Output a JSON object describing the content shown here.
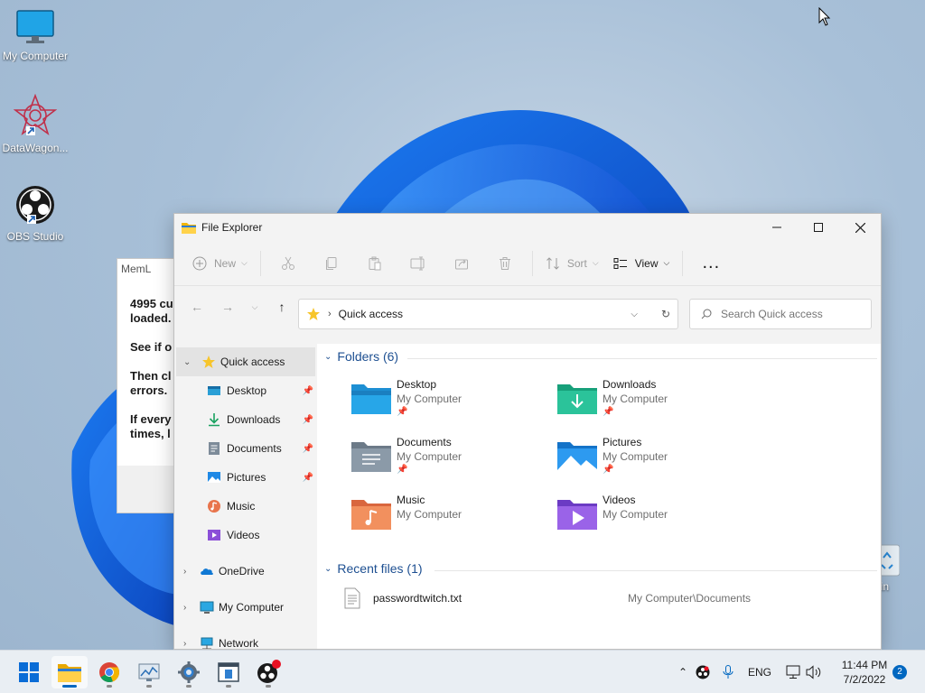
{
  "desktop": {
    "icons": [
      {
        "label": "My Computer"
      },
      {
        "label": "DataWagon..."
      },
      {
        "label": "OBS Studio"
      }
    ],
    "recycle_label": "le Bin"
  },
  "meml": {
    "title": "MemL",
    "lines": [
      "4995 cu",
      "loaded.",
      "See if o",
      "Then cl",
      "errors.",
      "If every",
      "times, l"
    ]
  },
  "explorer": {
    "title": "File Explorer",
    "commands": {
      "new": "New",
      "sort": "Sort",
      "view": "View",
      "more": "..."
    },
    "address": "Quick access",
    "search_placeholder": "Search Quick access",
    "nav": [
      {
        "label": "Quick access"
      },
      {
        "label": "Desktop"
      },
      {
        "label": "Downloads"
      },
      {
        "label": "Documents"
      },
      {
        "label": "Pictures"
      },
      {
        "label": "Music"
      },
      {
        "label": "Videos"
      },
      {
        "label": "OneDrive"
      },
      {
        "label": "My Computer"
      },
      {
        "label": "Network"
      }
    ],
    "folders_header": "Folders (6)",
    "folders": [
      {
        "name": "Desktop",
        "location": "My Computer",
        "pinned": true
      },
      {
        "name": "Downloads",
        "location": "My Computer",
        "pinned": true
      },
      {
        "name": "Documents",
        "location": "My Computer",
        "pinned": true
      },
      {
        "name": "Pictures",
        "location": "My Computer",
        "pinned": true
      },
      {
        "name": "Music",
        "location": "My Computer",
        "pinned": false
      },
      {
        "name": "Videos",
        "location": "My Computer",
        "pinned": false
      }
    ],
    "recent_header": "Recent files (1)",
    "recent": [
      {
        "name": "passwordtwitch.txt",
        "location": "My Computer\\Documents"
      }
    ]
  },
  "taskbar": {
    "language": "ENG",
    "time": "11:44 PM",
    "date": "7/2/2022",
    "notifications": "2"
  }
}
